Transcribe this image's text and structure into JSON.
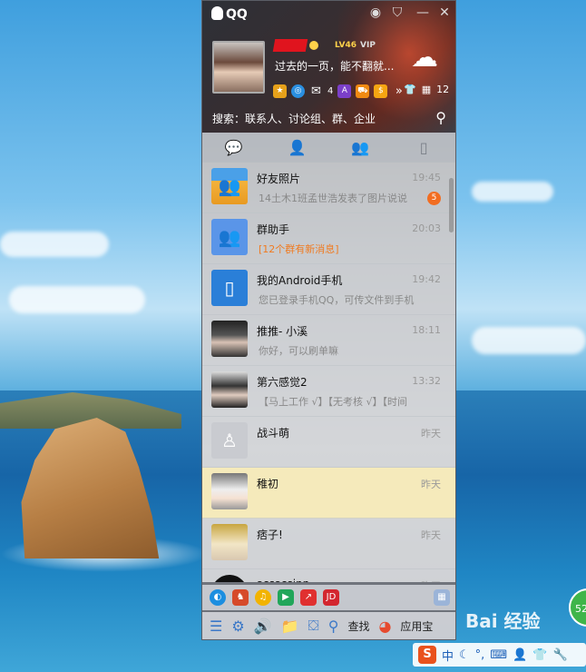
{
  "window": {
    "title": "QQ"
  },
  "profile": {
    "signature": "过去的一页，能不翻就...",
    "level_badge": "LV46",
    "vip_badge": "VIP",
    "mail_count": "4",
    "more_count": "12"
  },
  "search": {
    "placeholder": "搜索：联系人、讨论组、群、企业"
  },
  "tabs": [
    "messages",
    "contacts",
    "groups",
    "phone"
  ],
  "conversations": [
    {
      "name": "好友照片",
      "time": "19:45",
      "message": "14土木1班孟世浩发表了图片说说",
      "unread": "5",
      "avatar": "photo-folder",
      "highlight": false
    },
    {
      "name": "群助手",
      "time": "20:03",
      "message": "[12个群有新消息]",
      "unread": "",
      "avatar": "group-helper",
      "highlight": false
    },
    {
      "name": "我的Android手机",
      "time": "19:42",
      "message": "您已登录手机QQ，可传文件到手机",
      "unread": "",
      "avatar": "phone",
      "highlight": false
    },
    {
      "name": "推推- 小溪",
      "time": "18:11",
      "message": "你好，可以刷单嘛",
      "unread": "",
      "avatar": "girl-1",
      "highlight": false
    },
    {
      "name": "第六感觉2",
      "time": "13:32",
      "message": "【马上工作 √】【无考核 √】【时间",
      "unread": "",
      "avatar": "girl-2",
      "highlight": false
    },
    {
      "name": "战斗萌",
      "time": "昨天",
      "message": "",
      "unread": "",
      "avatar": "penguin-outline",
      "highlight": false
    },
    {
      "name": "稚初",
      "time": "昨天",
      "message": "",
      "unread": "",
      "avatar": "cartoon-1",
      "highlight": true
    },
    {
      "name": "痞子!",
      "time": "昨天",
      "message": "",
      "unread": "",
      "avatar": "cartoon-2",
      "highlight": false
    },
    {
      "name": "assassinn",
      "time": "昨天",
      "message": "",
      "unread": "",
      "avatar": "penguin",
      "highlight": false
    }
  ],
  "bottom_bar": {
    "find_label": "查找",
    "app_store_label": "应用宝",
    "jd_label": "JD"
  },
  "desktop": {
    "watermark": "Bai 经验",
    "float_ball": "52",
    "ime_label": "中"
  },
  "colors": {
    "accent": "#2b7fd4",
    "unread": "#f26d21",
    "group_msg": "#f07a20",
    "selected": "#fcf0be"
  }
}
